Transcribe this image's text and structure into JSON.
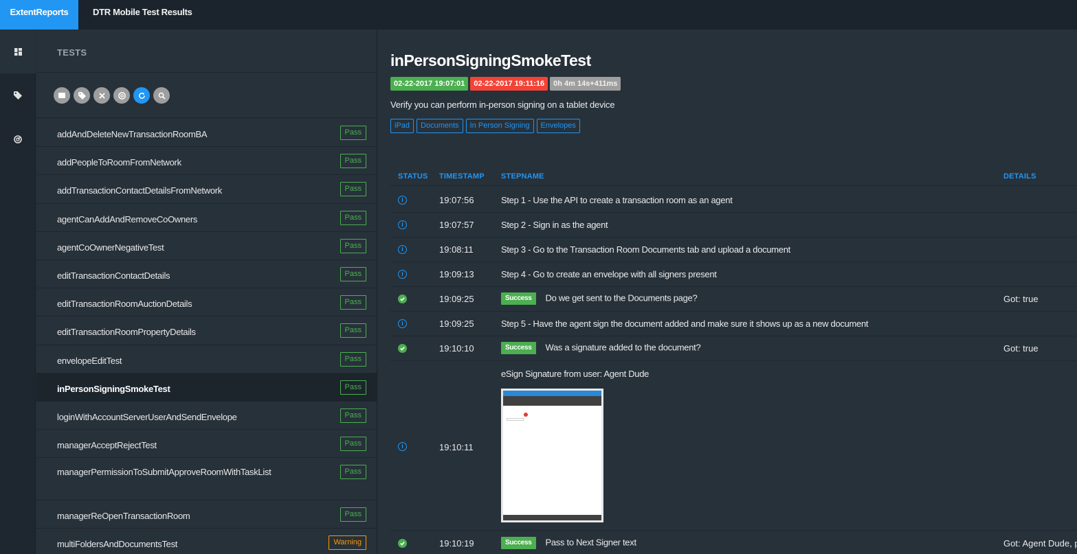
{
  "topbar": {
    "brand": "ExtentReports",
    "report_name": "DTR Mobile Test Results"
  },
  "nav": {
    "items": [
      {
        "icon": "dashboard-icon",
        "active": true
      },
      {
        "icon": "tag-icon",
        "active": false
      },
      {
        "icon": "gauge-icon",
        "active": false
      }
    ]
  },
  "tests": {
    "title": "TESTS",
    "toolbar": [
      "status-filter-icon",
      "tag-filter-icon",
      "clear-icon",
      "gauge-filter-icon",
      "refresh-icon",
      "search-icon"
    ],
    "items": [
      {
        "name": "addAndDeleteNewTransactionRoomBA",
        "status": "Pass"
      },
      {
        "name": "addPeopleToRoomFromNetwork",
        "status": "Pass"
      },
      {
        "name": "addTransactionContactDetailsFromNetwork",
        "status": "Pass"
      },
      {
        "name": "agentCanAddAndRemoveCoOwners",
        "status": "Pass"
      },
      {
        "name": "agentCoOwnerNegativeTest",
        "status": "Pass"
      },
      {
        "name": "editTransactionContactDetails",
        "status": "Pass"
      },
      {
        "name": "editTransactionRoomAuctionDetails",
        "status": "Pass"
      },
      {
        "name": "editTransactionRoomPropertyDetails",
        "status": "Pass"
      },
      {
        "name": "envelopeEditTest",
        "status": "Pass"
      },
      {
        "name": "inPersonSigningSmokeTest",
        "status": "Pass"
      },
      {
        "name": "loginWithAccountServerUserAndSendEnvelope",
        "status": "Pass"
      },
      {
        "name": "managerAcceptRejectTest",
        "status": "Pass"
      },
      {
        "name": "managerPermissionToSubmitApproveRoomWithTaskList",
        "status": "Pass"
      },
      {
        "name": "managerReOpenTransactionRoom",
        "status": "Pass"
      },
      {
        "name": "multiFoldersAndDocumentsTest",
        "status": "Warning"
      }
    ]
  },
  "detail": {
    "title": "inPersonSigningSmokeTest",
    "start": "02-22-2017 19:07:01",
    "end": "02-22-2017 19:11:16",
    "duration": "0h 4m 14s+411ms",
    "description": "Verify you can perform in-person signing on a tablet device",
    "categories": [
      "iPad",
      "Documents",
      "In Person Signing",
      "Envelopes"
    ],
    "columns": {
      "status": "STATUS",
      "timestamp": "TIMESTAMP",
      "stepname": "STEPNAME",
      "details": "DETAILS"
    },
    "logs": [
      {
        "status": "info",
        "time": "19:07:56",
        "step": "Step 1 - Use the API to create a transaction room as an agent",
        "label": "",
        "details": ""
      },
      {
        "status": "info",
        "time": "19:07:57",
        "step": "Step 2 - Sign in as the agent",
        "label": "",
        "details": ""
      },
      {
        "status": "info",
        "time": "19:08:11",
        "step": "Step 3 - Go to the Transaction Room Documents tab and upload a document",
        "label": "",
        "details": ""
      },
      {
        "status": "info",
        "time": "19:09:13",
        "step": "Step 4 - Go to create an envelope with all signers present",
        "label": "",
        "details": ""
      },
      {
        "status": "pass",
        "time": "19:09:25",
        "step": "Do we get sent to the Documents page?",
        "label": "Success",
        "details": "Got: true"
      },
      {
        "status": "info",
        "time": "19:09:25",
        "step": "Step 5 - Have the agent sign the document added and make sure it shows up as a new document",
        "label": "",
        "details": ""
      },
      {
        "status": "pass",
        "time": "19:10:10",
        "step": "Was a signature added to the document?",
        "label": "Success",
        "details": "Got: true"
      },
      {
        "status": "info",
        "time": "19:10:11",
        "step": "eSign Signature from user: Agent Dude",
        "label": "",
        "details": "",
        "screenshot": true
      },
      {
        "status": "pass",
        "time": "19:10:19",
        "step": "Pass to Next Signer text",
        "label": "Success",
        "details": "Got: Agent Dude, p"
      }
    ]
  }
}
